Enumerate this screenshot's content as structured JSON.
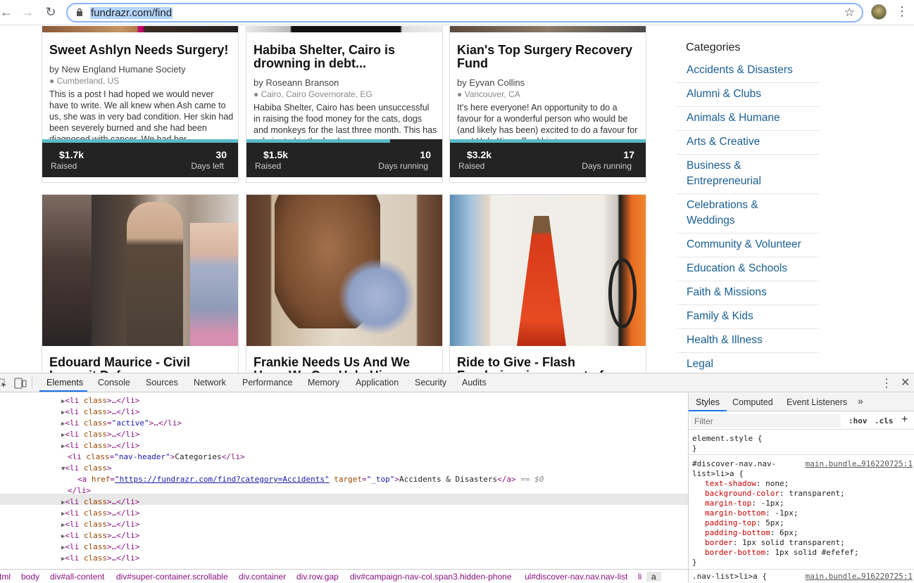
{
  "browser": {
    "url": "fundrazr.com/find",
    "back_icon": "arrow-left-icon",
    "forward_icon": "arrow-right-icon",
    "reload_icon": "reload-icon"
  },
  "cards": [
    {
      "title": "Sweet Ashlyn Needs Surgery!",
      "by": "by New England Humane Society",
      "location": "Cumberland, US",
      "desc": "This is a post I had hoped we would never have to write. We all knew when Ash came to us, she was in very bad condition. Her skin had been severely burned and she had been diagnosed with cancer. We had her",
      "raised": "$1.7k",
      "raised_label": "Raised",
      "days": "30",
      "days_label": "Days left",
      "progress": 1.0
    },
    {
      "title": "Habiba Shelter, Cairo is drowning in debt...",
      "by": "by Roseann Branson",
      "location": "Cairo, Cairo Governorate, EG",
      "desc": "Habiba Shelter, Cairo has been unsuccessful in raising the food money for the cats, dogs and monkeys for the last three month. This has culminated in the food",
      "raised": "$1.5k",
      "raised_label": "Raised",
      "days": "10",
      "days_label": "Days running",
      "progress": 0.73
    },
    {
      "title": "Kian's Top Surgery Recovery Fund",
      "by": "by Eyvan Collins",
      "location": "Vancouver, CA",
      "desc": "It's here everyone! An opportunity to do a favour for a wonderful person who would be (and likely has been) excited to do a favour for you! Help Kian afford his top surgery",
      "raised": "$3.2k",
      "raised_label": "Raised",
      "days": "17",
      "days_label": "Days running",
      "progress": 1.0
    },
    {
      "title": "Edouard Maurice - Civil Lawsuit Defence",
      "desc": ""
    },
    {
      "title": "Frankie Needs Us And We Hope We Can Help Him",
      "desc": ""
    },
    {
      "title": "Ride to Give - Flash Fundraiser in support of",
      "desc": ""
    }
  ],
  "sidebar": {
    "header": "Categories",
    "items": [
      "Accidents & Disasters",
      "Alumni & Clubs",
      "Animals & Humane",
      "Arts & Creative",
      "Business & Entrepreneurial",
      "Celebrations & Weddings",
      "Community & Volunteer",
      "Education & Schools",
      "Faith & Missions",
      "Family & Kids",
      "Health & Illness",
      "Legal"
    ]
  },
  "devtools": {
    "tabs": [
      "Elements",
      "Console",
      "Sources",
      "Network",
      "Performance",
      "Memory",
      "Application",
      "Security",
      "Audits"
    ],
    "style_tabs": [
      "Styles",
      "Computed",
      "Event Listeners"
    ],
    "filter_placeholder": "Filter",
    "hov": ":hov",
    "cls": ".cls",
    "selected_href": "https://fundrazr.com/find?category=Accidents",
    "selected_target": "_top",
    "selected_text": "Accidents & Disasters",
    "selected_suffix": "== $0",
    "nav_header_text": "Categories",
    "breadcrumbs": [
      "tml",
      "body",
      "div#all-content",
      "div#super-container.scrollable",
      "div.container",
      "div.row.gap",
      "div#campaign-nav-col.span3.hidden-phone",
      "ul#discover-nav.nav.nav-list",
      "li",
      "a"
    ],
    "element_style": "element.style {",
    "rule1_selector": "#discover-nav.nav-list>li>a {",
    "rule1_link": "main.bundle…916220725:1",
    "rule1_props": [
      [
        "text-shadow",
        "none;"
      ],
      [
        "background-color",
        "transparent;"
      ],
      [
        "margin-top",
        "-1px;"
      ],
      [
        "margin-bottom",
        "-1px;"
      ],
      [
        "padding-top",
        "5px;"
      ],
      [
        "padding-bottom",
        "6px;"
      ],
      [
        "border",
        "1px solid transparent;"
      ],
      [
        "border-bottom",
        "1px solid #efefef;"
      ]
    ],
    "rule2_selector": ".nav-list>li>a {",
    "rule2_link": "main.bundle…916220725:1"
  }
}
